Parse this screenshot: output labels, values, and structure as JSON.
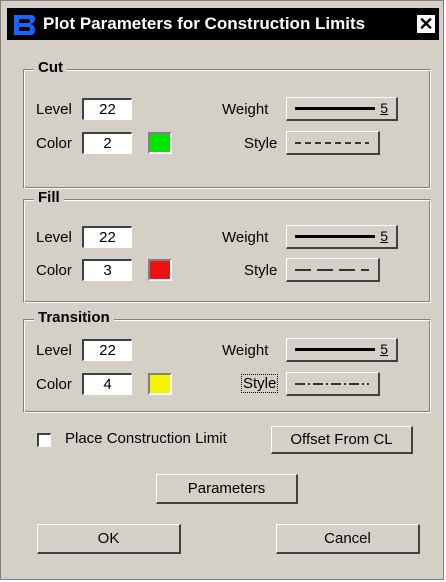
{
  "window": {
    "title": "Plot Parameters for Construction Limits",
    "close_glyph": "✕"
  },
  "groups": {
    "cut": {
      "title": "Cut",
      "level_label": "Level",
      "level_value": "22",
      "color_label": "Color",
      "color_value": "2",
      "swatch_color": "#00e600",
      "weight_label": "Weight",
      "weight_value": "5",
      "style_label": "Style"
    },
    "fill": {
      "title": "Fill",
      "level_label": "Level",
      "level_value": "22",
      "color_label": "Color",
      "color_value": "3",
      "swatch_color": "#ee1111",
      "weight_label": "Weight",
      "weight_value": "5",
      "style_label": "Style"
    },
    "transition": {
      "title": "Transition",
      "level_label": "Level",
      "level_value": "22",
      "color_label": "Color",
      "color_value": "4",
      "swatch_color": "#f4f400",
      "weight_label": "Weight",
      "weight_value": "5",
      "style_label": "Style"
    }
  },
  "options": {
    "place_construction_limit_label": "Place Construction Limit",
    "place_construction_limit_checked": false,
    "offset_button": "Offset From CL",
    "parameters_button": "Parameters"
  },
  "buttons": {
    "ok": "OK",
    "cancel": "Cancel"
  },
  "icons": {
    "app_logo": "bentley-b-logo-icon",
    "close": "close-icon"
  }
}
